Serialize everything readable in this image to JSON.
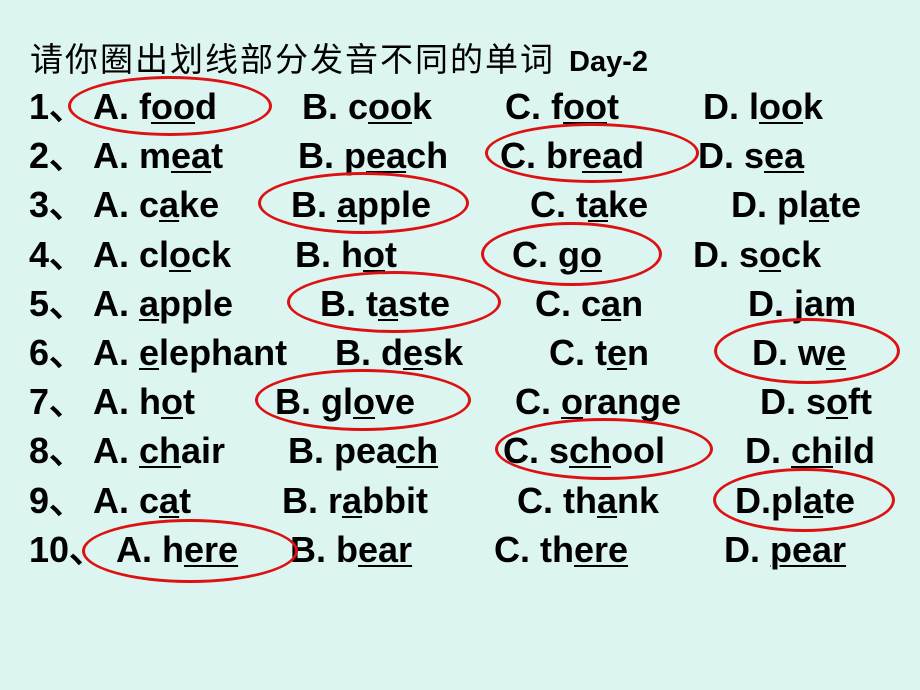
{
  "title": {
    "chinese": "请你圈出划线部分发音不同的单词",
    "day": "Day-2"
  },
  "colors": {
    "background": "#dcf5f1",
    "text": "#000000",
    "circle": "#dd1111"
  },
  "questions": [
    {
      "number": "1、",
      "answer": "A",
      "options": [
        {
          "letter": "A. ",
          "pre": "f",
          "u": "oo",
          "post": "d"
        },
        {
          "letter": "B. ",
          "pre": "c",
          "u": "oo",
          "post": "k"
        },
        {
          "letter": "C. ",
          "pre": "f",
          "u": "oo",
          "post": "t"
        },
        {
          "letter": "D. ",
          "pre": "l",
          "u": "oo",
          "post": "k"
        }
      ]
    },
    {
      "number": "2、",
      "answer": "C",
      "options": [
        {
          "letter": "A. ",
          "pre": "m",
          "u": "ea",
          "post": "t"
        },
        {
          "letter": "B. ",
          "pre": "p",
          "u": "ea",
          "post": "ch"
        },
        {
          "letter": "C. ",
          "pre": "br",
          "u": "ea",
          "post": "d"
        },
        {
          "letter": "D. ",
          "pre": "s",
          "u": "ea",
          "post": ""
        }
      ]
    },
    {
      "number": "3、",
      "answer": "B",
      "options": [
        {
          "letter": "A. ",
          "pre": "c",
          "u": "a",
          "post": "ke"
        },
        {
          "letter": "B. ",
          "pre": "",
          "u": "a",
          "post": "pple"
        },
        {
          "letter": "C. ",
          "pre": "t",
          "u": "a",
          "post": "ke"
        },
        {
          "letter": "D. ",
          "pre": "pl",
          "u": "a",
          "post": "te"
        }
      ]
    },
    {
      "number": "4、",
      "answer": "C",
      "options": [
        {
          "letter": "A. ",
          "pre": "cl",
          "u": "o",
          "post": "ck"
        },
        {
          "letter": "B. ",
          "pre": "h",
          "u": "o",
          "post": "t"
        },
        {
          "letter": "C. ",
          "pre": "g",
          "u": "o",
          "post": ""
        },
        {
          "letter": "D. ",
          "pre": "s",
          "u": "o",
          "post": "ck"
        }
      ]
    },
    {
      "number": "5、",
      "answer": "B",
      "options": [
        {
          "letter": "A. ",
          "pre": "",
          "u": "a",
          "post": "pple"
        },
        {
          "letter": "B. ",
          "pre": "t",
          "u": "a",
          "post": "ste"
        },
        {
          "letter": "C. ",
          "pre": "c",
          "u": "a",
          "post": "n"
        },
        {
          "letter": "D. ",
          "pre": "j",
          "u": "a",
          "post": "m"
        }
      ]
    },
    {
      "number": "6、",
      "answer": "D",
      "options": [
        {
          "letter": "A. ",
          "pre": "",
          "u": "e",
          "post": "lephant"
        },
        {
          "letter": "B. ",
          "pre": "d",
          "u": "e",
          "post": "sk"
        },
        {
          "letter": "C.  ",
          "pre": "t",
          "u": "e",
          "post": "n"
        },
        {
          "letter": "D. ",
          "pre": "w",
          "u": "e",
          "post": ""
        }
      ]
    },
    {
      "number": "7、",
      "answer": "B",
      "options": [
        {
          "letter": "A. ",
          "pre": "h",
          "u": "o",
          "post": "t"
        },
        {
          "letter": "B. ",
          "pre": "gl",
          "u": "o",
          "post": "ve"
        },
        {
          "letter": "C. ",
          "pre": "",
          "u": "o",
          "post": "range"
        },
        {
          "letter": "D. ",
          "pre": "s",
          "u": "o",
          "post": "ft"
        }
      ]
    },
    {
      "number": "8、",
      "answer": "C",
      "options": [
        {
          "letter": "A. ",
          "pre": "",
          "u": "ch",
          "post": "air"
        },
        {
          "letter": "B. ",
          "pre": "pea",
          "u": "ch",
          "post": ""
        },
        {
          "letter": "C. ",
          "pre": "s",
          "u": "ch",
          "post": "ool"
        },
        {
          "letter": "D. ",
          "pre": "",
          "u": "ch",
          "post": "ild"
        }
      ]
    },
    {
      "number": "9、",
      "answer": "D",
      "options": [
        {
          "letter": "A. ",
          "pre": "c",
          "u": "a",
          "post": "t"
        },
        {
          "letter": "B. ",
          "pre": "r",
          "u": "a",
          "post": "bbit"
        },
        {
          "letter": "C. ",
          "pre": "th",
          "u": "a",
          "post": "nk"
        },
        {
          "letter": "D.",
          "pre": "pl",
          "u": "a",
          "post": "te"
        }
      ]
    },
    {
      "number": "10、",
      "answer": "A",
      "options": [
        {
          "letter": "A. ",
          "pre": "h",
          "u": "ere",
          "post": ""
        },
        {
          "letter": "B. ",
          "pre": "b",
          "u": "ear",
          "post": ""
        },
        {
          "letter": "C. ",
          "pre": "th",
          "u": "ere",
          "post": ""
        },
        {
          "letter": "D. ",
          "pre": "",
          "u": "pear",
          "post": ""
        }
      ]
    }
  ]
}
